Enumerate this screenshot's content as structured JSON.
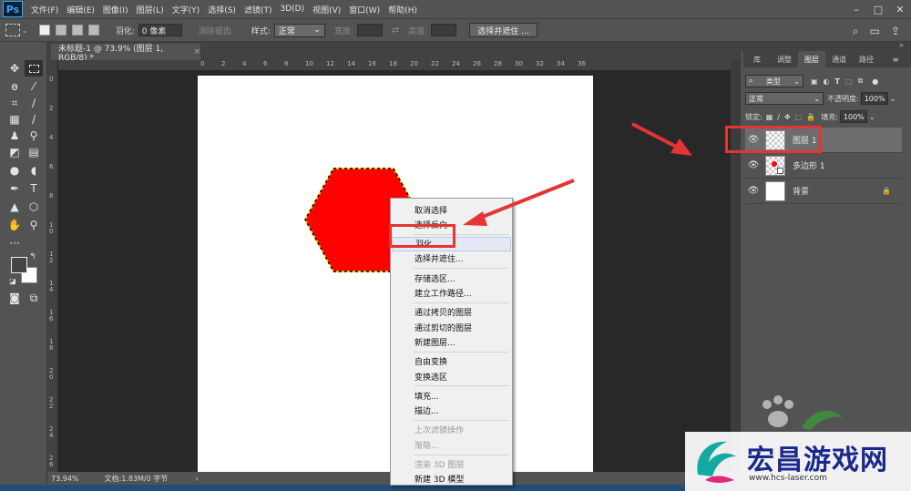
{
  "app": {
    "logo": "Ps"
  },
  "menu": [
    "文件(F)",
    "编辑(E)",
    "图像(I)",
    "图层(L)",
    "文字(Y)",
    "选择(S)",
    "滤镜(T)",
    "3D(D)",
    "视图(V)",
    "窗口(W)",
    "帮助(H)"
  ],
  "options": {
    "feather_label": "羽化:",
    "feather_value": "0 像素",
    "antialias_label": "消除锯齿",
    "style_label": "样式:",
    "style_value": "正常",
    "width_label": "宽度:",
    "height_label": "高度:",
    "select_mask_button": "选择并遮住 ..."
  },
  "document": {
    "tab_title": "未标题-1 @ 73.9% (图层 1, RGB/8) *",
    "zoom": "73.94%",
    "doc_info": "文档:1.83M/0 字节"
  },
  "rulers": {
    "h": [
      "0",
      "2",
      "4",
      "6",
      "8",
      "10",
      "12",
      "14",
      "16",
      "18",
      "20",
      "22",
      "24",
      "26",
      "28",
      "30",
      "32",
      "34",
      "36"
    ],
    "v": [
      "0",
      "2",
      "4",
      "6",
      "8",
      "1\n0",
      "1\n2",
      "1\n4",
      "1\n6",
      "1\n8",
      "2\n0",
      "2\n2",
      "2\n4",
      "2\n6"
    ]
  },
  "panel": {
    "tabs": [
      "库",
      "调整",
      "图层",
      "通道",
      "路径"
    ],
    "active_tab": "图层",
    "filter_kind": "类型",
    "blend_mode": "正常",
    "opacity_label": "不透明度:",
    "opacity_value": "100%",
    "lock_label": "锁定:",
    "fill_label": "填充:",
    "fill_value": "100%",
    "layers": [
      {
        "name": "图层 1",
        "selected": true
      },
      {
        "name": "多边形 1",
        "selected": false
      },
      {
        "name": "背景",
        "selected": false,
        "locked": true
      }
    ]
  },
  "context_menu": {
    "groups": [
      [
        "取消选择",
        "选择反向"
      ],
      [
        "羽化...",
        "选择并遮住..."
      ],
      [
        "存储选区...",
        "建立工作路径..."
      ],
      [
        "通过拷贝的图层",
        "通过剪切的图层",
        "新建图层..."
      ],
      [
        "自由变换",
        "变换选区"
      ],
      [
        "填充...",
        "描边..."
      ],
      [
        "上次滤镜操作",
        "渐隐..."
      ],
      [
        "渲染 3D 图层",
        "新建 3D 模型"
      ]
    ],
    "disabled": [
      "上次滤镜操作",
      "渐隐...",
      "渲染 3D 图层"
    ],
    "highlighted": "羽化..."
  },
  "colors": {
    "shape_fill": "#ff0000",
    "annotation": "#e53434",
    "ps_blue": "#31a8ff"
  },
  "watermark": {
    "title": "宏昌游戏网",
    "url": "www.hcs-laser.com"
  }
}
